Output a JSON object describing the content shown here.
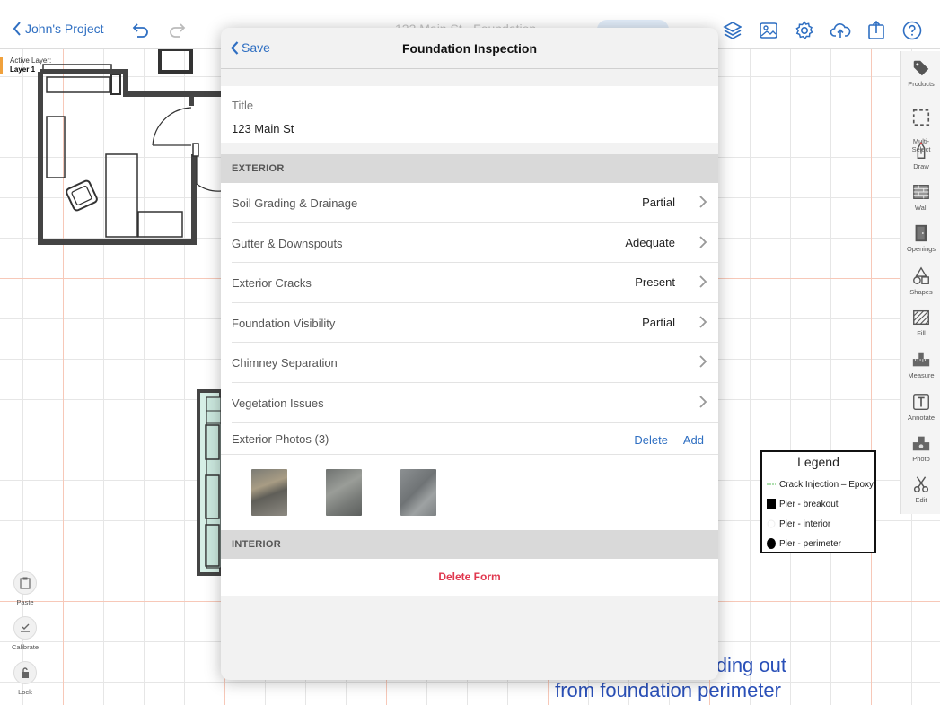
{
  "topbar": {
    "back_label": "John's Project",
    "doc_title": "123 Main St · Foundation",
    "icons": [
      "undo-icon",
      "redo-icon",
      "pencil-icon",
      "layers-icon",
      "image-icon",
      "gear-icon",
      "cloud-upload-icon",
      "share-icon",
      "help-icon"
    ]
  },
  "active_layer": {
    "label": "Active Layer:",
    "value": "Layer 1"
  },
  "right_toolbar": {
    "items": [
      {
        "label": "Products",
        "icon": "tag-icon"
      },
      {
        "label": "Multi-\nSelect",
        "icon": "multi-select-icon"
      },
      {
        "label": "Draw",
        "icon": "draw-icon"
      },
      {
        "label": "Wall",
        "icon": "wall-icon"
      },
      {
        "label": "Openings",
        "icon": "door-icon"
      },
      {
        "label": "Shapes",
        "icon": "shapes-icon"
      },
      {
        "label": "Fill",
        "icon": "fill-icon"
      },
      {
        "label": "Measure",
        "icon": "measure-icon"
      },
      {
        "label": "Annotate",
        "icon": "text-icon"
      },
      {
        "label": "Photo",
        "icon": "camera-icon"
      },
      {
        "label": "Edit",
        "icon": "scissors-icon"
      }
    ]
  },
  "left_tools": {
    "items": [
      {
        "label": "Paste",
        "icon": "paste-icon"
      },
      {
        "label": "Calibrate",
        "icon": "calibrate-icon"
      },
      {
        "label": "Lock",
        "icon": "lock-icon"
      }
    ]
  },
  "legend": {
    "title": "Legend",
    "items": [
      {
        "label": "Crack Injection – Epoxy",
        "symbol": "dashed-green-line"
      },
      {
        "label": "Pier - breakout",
        "symbol": "black-square"
      },
      {
        "label": "Pier - interior",
        "symbol": "white-circle"
      },
      {
        "label": "Pier - perimeter",
        "symbol": "black-oval"
      }
    ]
  },
  "annotation": {
    "line1": "ding out",
    "line2": "from foundation perimeter",
    "color": "#2a50b8"
  },
  "modal": {
    "save_label": "Save",
    "title": "Foundation Inspection",
    "title_field": {
      "label": "Title",
      "value": "123 Main St"
    },
    "exterior_header": "EXTERIOR",
    "rows": [
      {
        "label": "Soil Grading & Drainage",
        "value": "Partial"
      },
      {
        "label": "Gutter & Downspouts",
        "value": "Adequate"
      },
      {
        "label": "Exterior Cracks",
        "value": "Present"
      },
      {
        "label": "Foundation Visibility",
        "value": "Partial"
      },
      {
        "label": "Chimney Separation",
        "value": ""
      },
      {
        "label": "Vegetation Issues",
        "value": ""
      }
    ],
    "photos": {
      "label": "Exterior Photos (3)",
      "delete_label": "Delete",
      "add_label": "Add",
      "count": 3
    },
    "interior_header": "INTERIOR",
    "delete_form_label": "Delete Form"
  },
  "colors": {
    "accent": "#2f6fc2",
    "destructive": "#e0374e",
    "section_bg": "#d9d9d9"
  }
}
